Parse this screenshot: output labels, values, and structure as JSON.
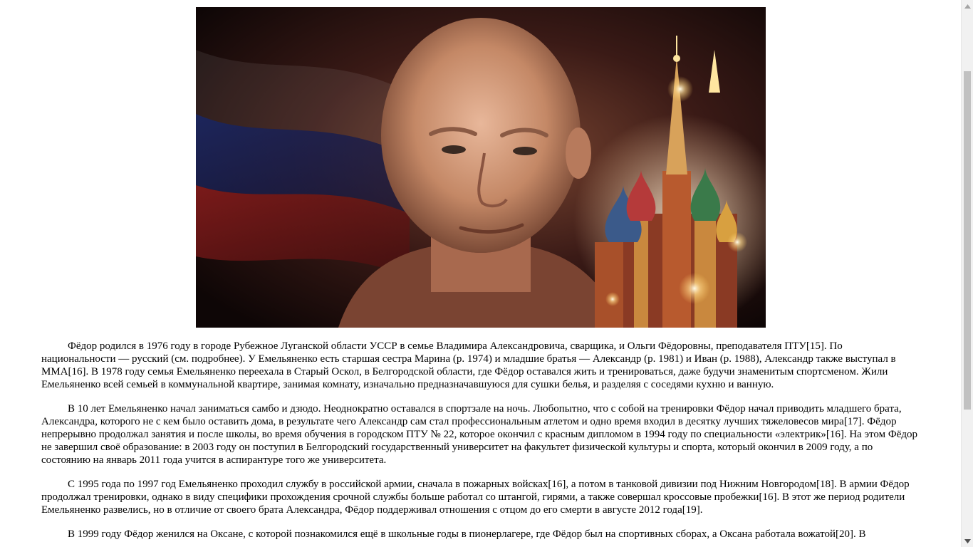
{
  "hero_image": {
    "alt": "Фёдор Емельяненко"
  },
  "article": {
    "paragraphs": [
      "Фёдор родился в 1976 году в городе Рубежное Луганской области УССР в семье Владимира Александровича, сварщика, и Ольги Фёдоровны, преподавателя ПТУ[15]. По национальности — русский (см. подробнее). У Емельяненко есть старшая сестра Марина (р. 1974) и младшие братья — Александр (р. 1981) и Иван (р. 1988), Александр также выступал в ММА[16]. В 1978 году семья Емельяненко переехала в Старый Оскол, в Белгородской области, где Фёдор оставался жить и тренироваться, даже будучи знаменитым спортсменом. Жили Емельяненко всей семьей в коммунальной квартире, занимая комнату, изначально предназначавшуюся для сушки белья, и разделяя с соседями кухню и ванную.",
      "В 10 лет Емельяненко начал заниматься самбо и дзюдо. Неоднократно оставался в спортзале на ночь. Любопытно, что с собой на тренировки Фёдор начал приводить младшего брата, Александра, которого не с кем было оставить дома, в результате чего Александр сам стал профессиональным атлетом и одно время входил в десятку лучших тяжеловесов мира[17]. Фёдор непрерывно продолжал занятия и после школы, во время обучения в городском ПТУ № 22, которое окончил с красным дипломом в 1994 году по специальности «электрик»[16]. На этом Фёдор не завершил своё образование: в 2003 году он поступил в Белгородский государственный университет на факультет физической культуры и спорта, который окончил в 2009 году, а по состоянию на январь 2011 года учится в аспирантуре того же университета.",
      "С 1995 года по 1997 год Емельяненко проходил службу в российской армии, сначала в пожарных войсках[16], а потом в танковой дивизии под Нижним Новгородом[18]. В армии Фёдор продолжал тренировки, однако в виду специфики прохождения срочной службы больше работал со штангой, гирями, а также совершал кроссовые пробежки[16]. В этот же период родители Емельяненко развелись, но в отличие от своего брата Александра, Фёдор поддерживал отношения с отцом до его смерти в августе 2012 года[19].",
      "В 1999 году Фёдор женился на Оксане, с которой познакомился ещё в школьные годы в пионерлагере, где Фёдор был на спортивных сборах, а Оксана работала вожатой[20]. В"
    ]
  },
  "colors": {
    "background": "#ffffff",
    "text": "#000000",
    "scrollbar_track": "#f1f1f1",
    "scrollbar_thumb": "#c1c1c1"
  }
}
